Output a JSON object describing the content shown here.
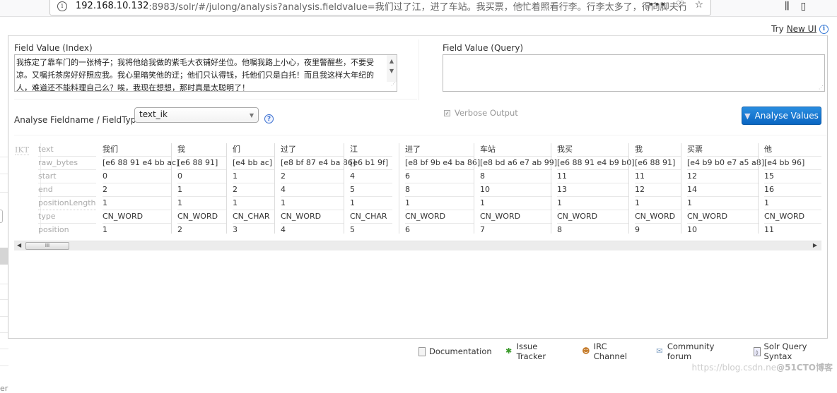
{
  "browser": {
    "url_host": "192.168.10.132",
    "url_rest": ":8983/solr/#/julong/analysis?analysis.fieldvalue=我们过了江，进了车站。我买票，他忙着照看行李。行李太多了，得向脚夫行些小费才",
    "more_label": "•••"
  },
  "try_new_ui": {
    "prefix": "Try ",
    "link": "New UI"
  },
  "field_value_index": {
    "label": "Field Value (Index)",
    "value": "我拣定了靠车门的一张椅子；我将他给我做的紫毛大衣铺好坐位。他嘱我路上小心，夜里警醒些，不要受凉。又嘱托茶房好好照应我。我心里暗笑他的迂；他们只认得钱，托他们只是白托！而且我这样大年纪的人，难道还不能料理自己么？唉，我现在想想，那时真是太聪明了！"
  },
  "field_value_query": {
    "label": "Field Value (Query)",
    "value": ""
  },
  "analyse": {
    "fieldname_label": "Analyse Fieldname / FieldType:",
    "selected_fieldtype": "text_ik",
    "help_glyph": "?",
    "verbose_label": "Verbose Output",
    "verbose_checked": true,
    "button_label": "Analyse Values"
  },
  "analysis": {
    "tokenizer": "IKT",
    "row_headers": [
      "text",
      "raw_bytes",
      "start",
      "end",
      "positionLength",
      "type",
      "position"
    ],
    "tokens": [
      {
        "text": "我们",
        "raw_bytes": "[e6 88 91 e4 bb ac]",
        "start": "0",
        "end": "2",
        "positionLength": "1",
        "type": "CN_WORD",
        "position": "1"
      },
      {
        "text": "我",
        "raw_bytes": "[e6 88 91]",
        "start": "0",
        "end": "1",
        "positionLength": "1",
        "type": "CN_WORD",
        "position": "2"
      },
      {
        "text": "们",
        "raw_bytes": "[e4 bb ac]",
        "start": "1",
        "end": "2",
        "positionLength": "1",
        "type": "CN_CHAR",
        "position": "3"
      },
      {
        "text": "过了",
        "raw_bytes": "[e8 bf 87 e4 ba 86]",
        "start": "2",
        "end": "4",
        "positionLength": "1",
        "type": "CN_WORD",
        "position": "4"
      },
      {
        "text": "江",
        "raw_bytes": "[e6 b1 9f]",
        "start": "4",
        "end": "5",
        "positionLength": "1",
        "type": "CN_CHAR",
        "position": "5"
      },
      {
        "text": "进了",
        "raw_bytes": "[e8 bf 9b e4 ba 86]",
        "start": "6",
        "end": "8",
        "positionLength": "1",
        "type": "CN_WORD",
        "position": "6"
      },
      {
        "text": "车站",
        "raw_bytes": "[e8 bd a6 e7 ab 99]",
        "start": "8",
        "end": "10",
        "positionLength": "1",
        "type": "CN_WORD",
        "position": "7"
      },
      {
        "text": "我买",
        "raw_bytes": "[e6 88 91 e4 b9 b0]",
        "start": "11",
        "end": "13",
        "positionLength": "1",
        "type": "CN_WORD",
        "position": "8"
      },
      {
        "text": "我",
        "raw_bytes": "[e6 88 91]",
        "start": "11",
        "end": "12",
        "positionLength": "1",
        "type": "CN_WORD",
        "position": "9"
      },
      {
        "text": "买票",
        "raw_bytes": "[e4 b9 b0 e7 a5 a8]",
        "start": "12",
        "end": "14",
        "positionLength": "1",
        "type": "CN_WORD",
        "position": "10"
      },
      {
        "text": "他",
        "raw_bytes": "[e4 bb 96]",
        "start": "15",
        "end": "16",
        "positionLength": "1",
        "type": "CN_WORD",
        "position": "11"
      }
    ]
  },
  "footer": {
    "links": [
      {
        "label": "Documentation",
        "icon": "document-icon"
      },
      {
        "label": "Issue Tracker",
        "icon": "bug-icon"
      },
      {
        "label": "IRC Channel",
        "icon": "people-icon"
      },
      {
        "label": "Community forum",
        "icon": "mail-icon"
      },
      {
        "label": "Solr Query Syntax",
        "icon": "query-doc-icon"
      }
    ]
  },
  "watermark": {
    "url": "https://blog.csdn.ne",
    "brand": "@51CTO博客"
  },
  "sidebar_fragment": {
    "text": "er"
  }
}
